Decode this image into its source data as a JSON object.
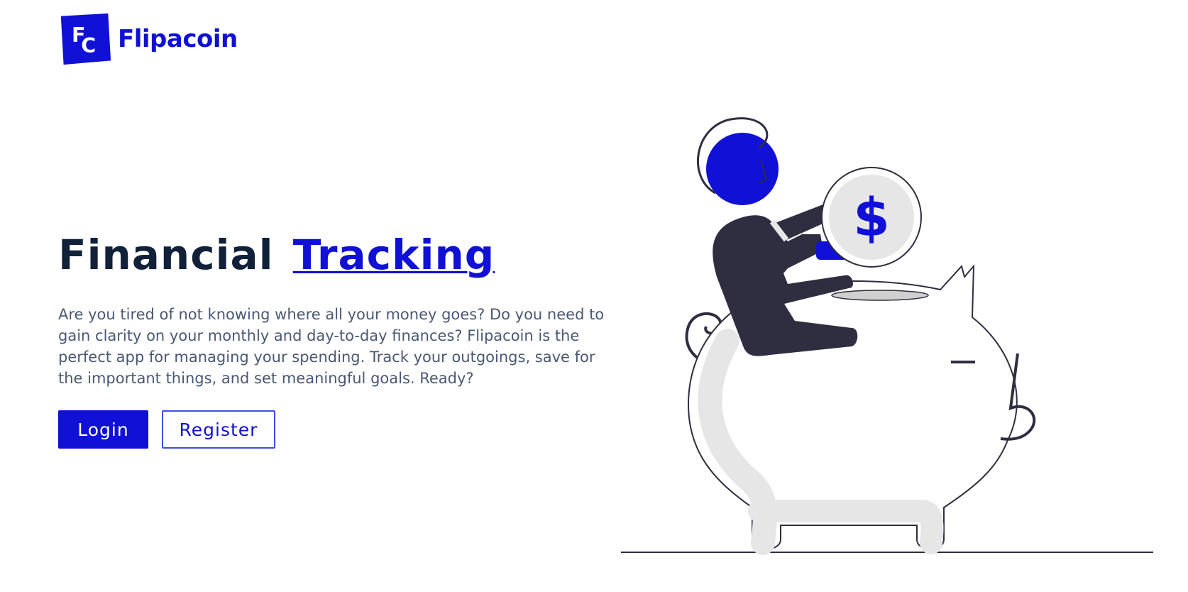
{
  "brand": {
    "name": "Flipacoin",
    "monogram_top": "F",
    "monogram_bottom": "C",
    "color": "#1010d6"
  },
  "hero": {
    "title_main": "Financial",
    "title_accent": "Tracking",
    "description": "Are you tired of not knowing where all your money goes? Do you need to gain clarity on your monthly and day-to-day finances? Flipacoin is the perfect app for managing your spending. Track your outgoings, save for the important things, and set meaningful goals. Ready?",
    "title_color": "#12213a",
    "text_color": "#4a5874"
  },
  "actions": {
    "login_label": "Login",
    "register_label": "Register"
  },
  "illustration": {
    "coin_symbol": "$",
    "icon": "person-putting-coin-in-piggy-bank",
    "accent_color": "#1010d6",
    "dark_color": "#2f2e41",
    "light_color": "#e6e6e6"
  }
}
